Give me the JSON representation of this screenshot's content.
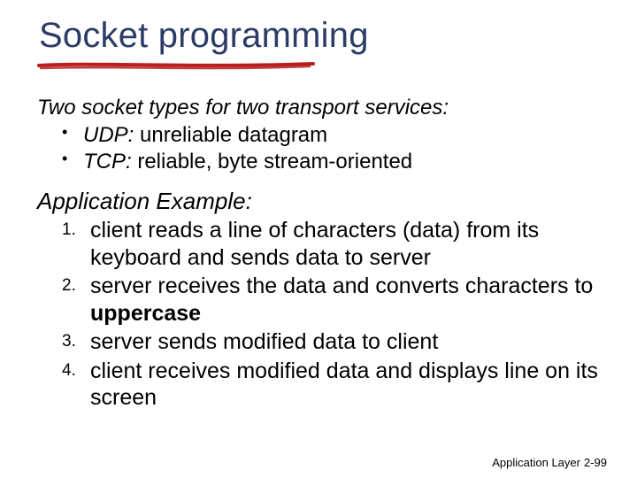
{
  "title": "Socket programming",
  "intro": "Two socket types for two transport services:",
  "bullets": [
    {
      "label": "UDP:",
      "text": " unreliable datagram"
    },
    {
      "label": "TCP:",
      "text": " reliable, byte stream-oriented"
    }
  ],
  "example_heading": "Application Example:",
  "steps": [
    {
      "pre": "client reads a line of characters (data) from its keyboard and sends data to server",
      "bold": "",
      "post": ""
    },
    {
      "pre": "server receives the data and converts characters to ",
      "bold": "uppercase",
      "post": ""
    },
    {
      "pre": "server sends modified data to client",
      "bold": "",
      "post": ""
    },
    {
      "pre": "client receives modified data and displays line on its screen",
      "bold": "",
      "post": ""
    }
  ],
  "footer": {
    "section": "Application Layer",
    "page": "2-99"
  },
  "colors": {
    "title": "#2b3c66",
    "underline": "#b91e1e"
  }
}
